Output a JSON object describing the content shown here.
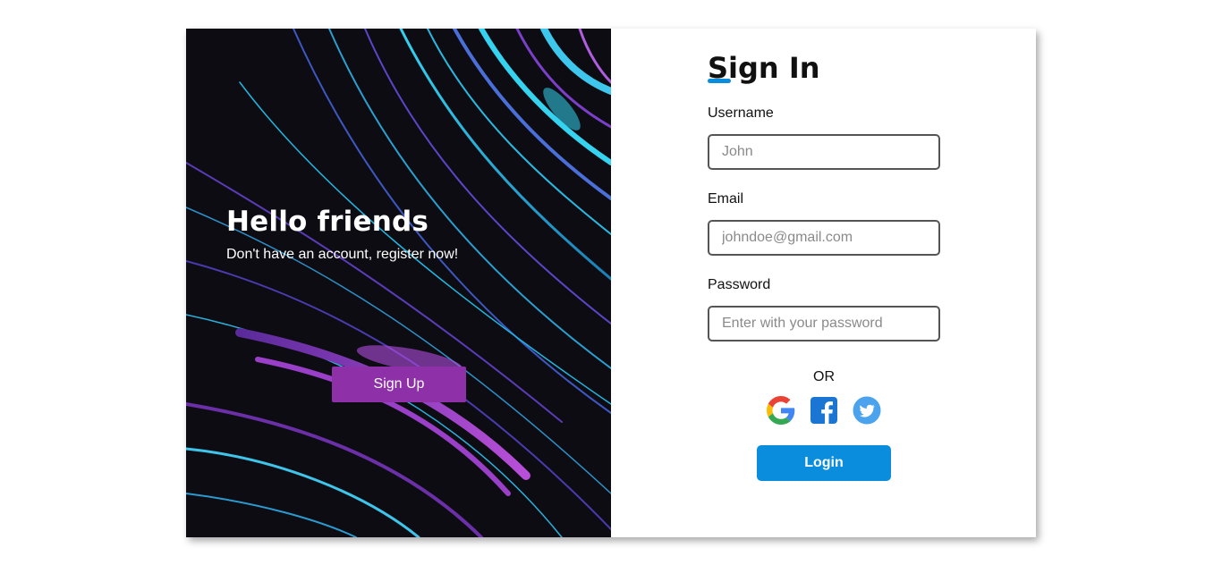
{
  "welcome": {
    "heading": "Hello friends",
    "subtext": "Don't have an account, register now!",
    "signup_label": "Sign Up"
  },
  "signin": {
    "title": "Sign In",
    "username": {
      "label": "Username",
      "placeholder": "John"
    },
    "email": {
      "label": "Email",
      "placeholder": "johndoe@gmail.com"
    },
    "password": {
      "label": "Password",
      "placeholder": "Enter with your password"
    },
    "or_text": "OR",
    "socials": [
      "google-icon",
      "facebook-icon",
      "twitter-icon"
    ],
    "login_label": "Login"
  },
  "colors": {
    "accent_blue": "#0a8ddc",
    "signup_purple": "#8e30a8",
    "panel_dark": "#0d0c12"
  }
}
